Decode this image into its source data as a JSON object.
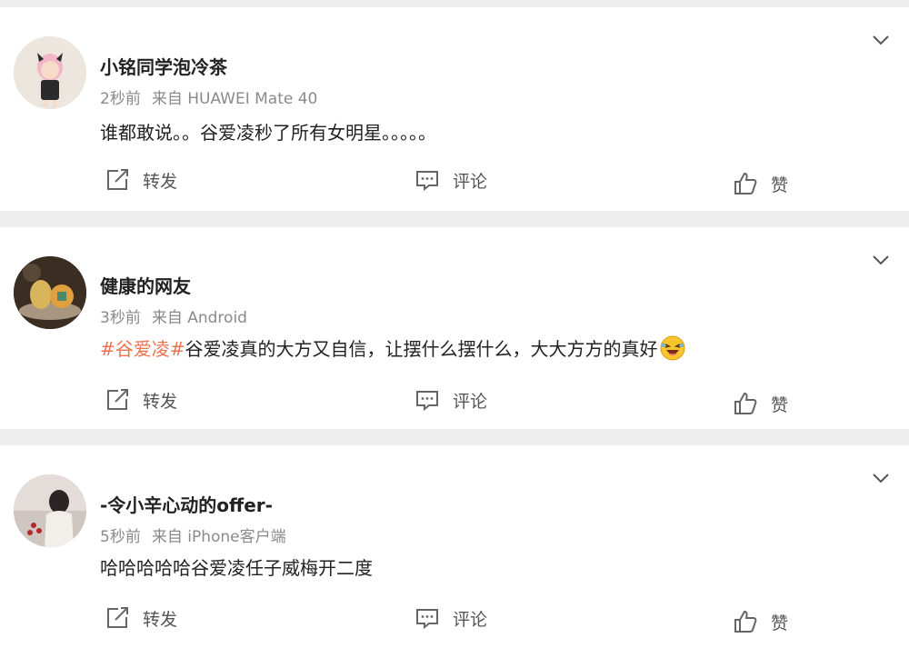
{
  "posts": [
    {
      "username": "小铭同学泡冷茶",
      "time": "2秒前",
      "source": "来自 HUAWEI Mate 40",
      "text": "谁都敢说。。谷爱凌秒了所有女明星。。。。。",
      "actions": {
        "repost": "转发",
        "comment": "评论",
        "like": "赞"
      }
    },
    {
      "username": "健康的网友",
      "time": "3秒前",
      "source": "来自 Android",
      "hashtag": "#谷爱凌#",
      "text": "谷爱凌真的大方又自信，让摆什么摆什么，大大方方的真好",
      "emoji": "laughing-emoji",
      "actions": {
        "repost": "转发",
        "comment": "评论",
        "like": "赞"
      }
    },
    {
      "username": "-令小辛心动的offer-",
      "time": "5秒前",
      "source": "来自 iPhone客户端",
      "text": "哈哈哈哈哈谷爱凌任子威梅开二度",
      "actions": {
        "repost": "转发",
        "comment": "评论",
        "like": "赞"
      }
    }
  ],
  "colors": {
    "hashtag": "#eb7350",
    "meta": "#8a8a8a",
    "background": "#eeeeee"
  },
  "icons": [
    "chevron-down-icon",
    "repost-icon",
    "comment-icon",
    "like-icon"
  ]
}
